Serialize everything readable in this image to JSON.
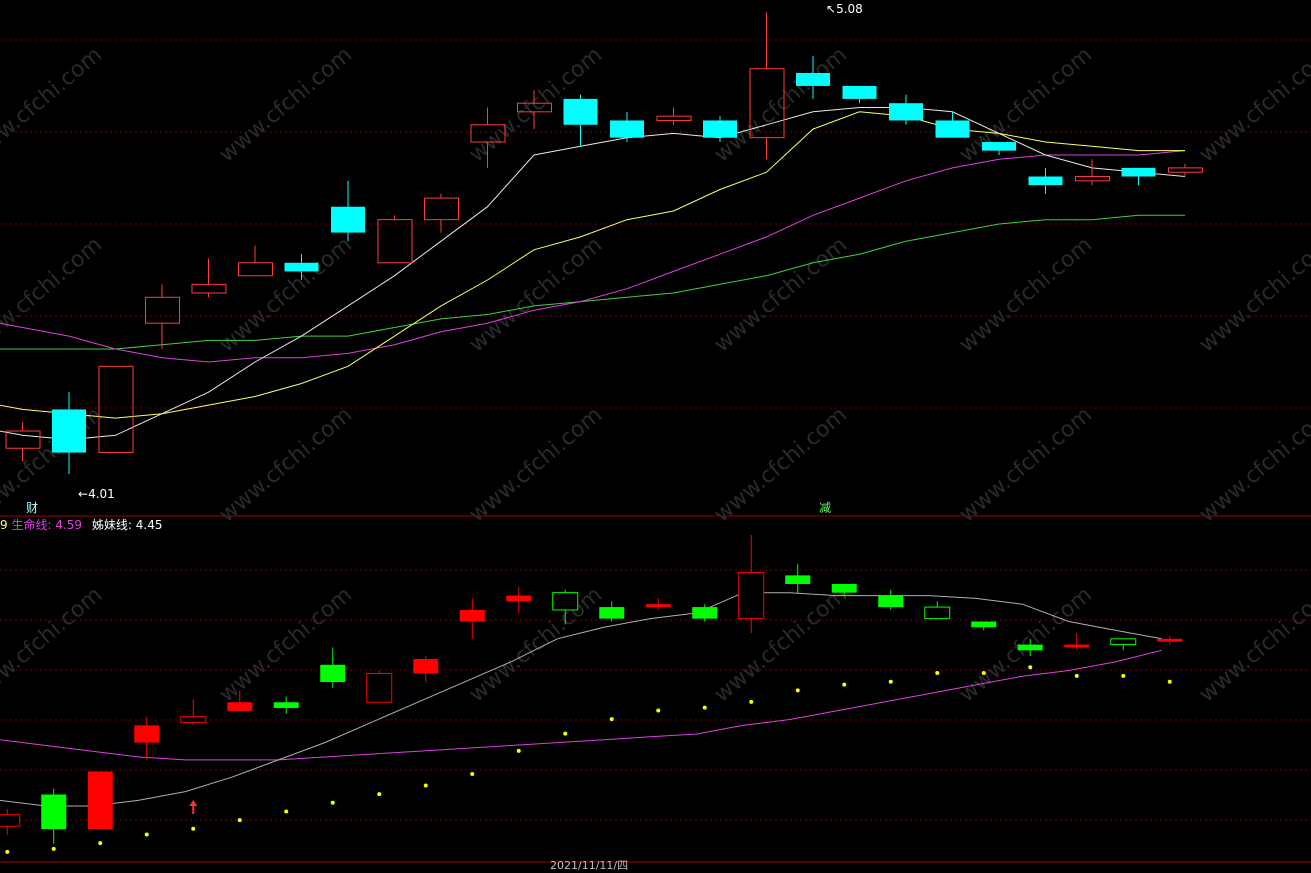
{
  "colors": {
    "background": "#000000",
    "grid": "#7a0000",
    "divider": "#a00000",
    "up_outline": "#ff3c3c",
    "down_fill": "#00ffff",
    "sub_up_fill": "#ff0000",
    "sub_down_fill": "#00ff00",
    "ma_white": "#e8e8e8",
    "ma_yellow": "#ffff66",
    "ma_magenta": "#e040e0",
    "ma_green": "#40d040",
    "dot_yellow": "#ffff00",
    "label_white": "#ffffff",
    "label_magenta": "#e040e0",
    "marker_cai": "#b0ffff",
    "marker_jian": "#60ff60"
  },
  "markers": {
    "high_price": "5.08",
    "low_price": "4.01",
    "cai": "财",
    "jian": "减"
  },
  "indicator_labels": {
    "prefix": "9",
    "life_line_label": "生命线:",
    "life_line_value": "4.59",
    "sister_line_label": "姊妹线:",
    "sister_line_value": "4.45"
  },
  "date_axis": {
    "label": "2021/11/11/四"
  },
  "watermark": {
    "text": "www.cfchi.com"
  },
  "chart_data": {
    "type": "candlestick",
    "price_range": [
      3.95,
      5.1
    ],
    "candles": [
      {
        "o": 4.18,
        "c": 4.07,
        "h": 4.19,
        "l": 4.05
      },
      {
        "o": 4.07,
        "c": 4.11,
        "h": 4.13,
        "l": 4.04
      },
      {
        "o": 4.16,
        "c": 4.06,
        "h": 4.2,
        "l": 4.01
      },
      {
        "o": 4.06,
        "c": 4.26,
        "h": 4.26,
        "l": 4.06
      },
      {
        "o": 4.36,
        "c": 4.42,
        "h": 4.45,
        "l": 4.3
      },
      {
        "o": 4.43,
        "c": 4.45,
        "h": 4.51,
        "l": 4.42
      },
      {
        "o": 4.47,
        "c": 4.5,
        "h": 4.54,
        "l": 4.47
      },
      {
        "o": 4.5,
        "c": 4.48,
        "h": 4.52,
        "l": 4.46
      },
      {
        "o": 4.63,
        "c": 4.57,
        "h": 4.69,
        "l": 4.55
      },
      {
        "o": 4.5,
        "c": 4.6,
        "h": 4.61,
        "l": 4.5
      },
      {
        "o": 4.6,
        "c": 4.65,
        "h": 4.66,
        "l": 4.57
      },
      {
        "o": 4.78,
        "c": 4.82,
        "h": 4.86,
        "l": 4.72
      },
      {
        "o": 4.85,
        "c": 4.87,
        "h": 4.9,
        "l": 4.81
      },
      {
        "o": 4.88,
        "c": 4.82,
        "h": 4.89,
        "l": 4.77
      },
      {
        "o": 4.83,
        "c": 4.79,
        "h": 4.85,
        "l": 4.78
      },
      {
        "o": 4.83,
        "c": 4.84,
        "h": 4.86,
        "l": 4.82
      },
      {
        "o": 4.83,
        "c": 4.79,
        "h": 4.84,
        "l": 4.78
      },
      {
        "o": 4.79,
        "c": 4.95,
        "h": 5.08,
        "l": 4.74
      },
      {
        "o": 4.94,
        "c": 4.91,
        "h": 4.98,
        "l": 4.88
      },
      {
        "o": 4.91,
        "c": 4.88,
        "h": 4.91,
        "l": 4.87
      },
      {
        "o": 4.87,
        "c": 4.83,
        "h": 4.89,
        "l": 4.82
      },
      {
        "o": 4.83,
        "c": 4.79,
        "h": 4.85,
        "l": 4.79
      },
      {
        "o": 4.78,
        "c": 4.76,
        "h": 4.78,
        "l": 4.75
      },
      {
        "o": 4.7,
        "c": 4.68,
        "h": 4.72,
        "l": 4.66
      },
      {
        "o": 4.69,
        "c": 4.7,
        "h": 4.74,
        "l": 4.68
      },
      {
        "o": 4.72,
        "c": 4.7,
        "h": 4.72,
        "l": 4.68
      },
      {
        "o": 4.71,
        "c": 4.72,
        "h": 4.73,
        "l": 4.7
      }
    ],
    "ma_white": [
      4.12,
      4.1,
      4.09,
      4.1,
      4.15,
      4.2,
      4.27,
      4.33,
      4.4,
      4.47,
      4.55,
      4.63,
      4.75,
      4.77,
      4.79,
      4.8,
      4.79,
      4.82,
      4.85,
      4.86,
      4.86,
      4.85,
      4.8,
      4.75,
      4.72,
      4.71,
      4.7
    ],
    "ma_yellow": [
      4.18,
      4.16,
      4.15,
      4.14,
      4.15,
      4.17,
      4.19,
      4.22,
      4.26,
      4.33,
      4.4,
      4.46,
      4.53,
      4.56,
      4.6,
      4.62,
      4.67,
      4.71,
      4.81,
      4.85,
      4.84,
      4.81,
      4.8,
      4.78,
      4.77,
      4.76,
      4.76
    ],
    "ma_magenta": [
      4.37,
      4.35,
      4.33,
      4.3,
      4.28,
      4.27,
      4.28,
      4.28,
      4.29,
      4.31,
      4.34,
      4.36,
      4.39,
      4.41,
      4.44,
      4.48,
      4.52,
      4.56,
      4.61,
      4.65,
      4.69,
      4.72,
      4.74,
      4.75,
      4.75,
      4.75,
      4.76
    ],
    "ma_green": [
      4.3,
      4.3,
      4.3,
      4.3,
      4.31,
      4.32,
      4.32,
      4.33,
      4.33,
      4.35,
      4.37,
      4.38,
      4.4,
      4.41,
      4.42,
      4.43,
      4.45,
      4.47,
      4.5,
      4.52,
      4.55,
      4.57,
      4.59,
      4.6,
      4.6,
      4.61,
      4.61
    ],
    "sub_range": [
      4.05,
      5.08
    ],
    "sub_candles": [
      {
        "o": 4.07,
        "c": 4.11,
        "h": 4.13,
        "l": 4.04
      },
      {
        "o": 4.18,
        "c": 4.06,
        "h": 4.2,
        "l": 4.01
      },
      {
        "o": 4.06,
        "c": 4.26,
        "h": 4.26,
        "l": 4.06
      },
      {
        "o": 4.36,
        "c": 4.42,
        "h": 4.45,
        "l": 4.3
      },
      {
        "o": 4.43,
        "c": 4.45,
        "h": 4.51,
        "l": 4.42
      },
      {
        "o": 4.47,
        "c": 4.5,
        "h": 4.54,
        "l": 4.47
      },
      {
        "o": 4.5,
        "c": 4.48,
        "h": 4.52,
        "l": 4.46
      },
      {
        "o": 4.63,
        "c": 4.57,
        "h": 4.69,
        "l": 4.55
      },
      {
        "o": 4.5,
        "c": 4.6,
        "h": 4.61,
        "l": 4.5
      },
      {
        "o": 4.6,
        "c": 4.65,
        "h": 4.66,
        "l": 4.57
      },
      {
        "o": 4.78,
        "c": 4.82,
        "h": 4.86,
        "l": 4.72
      },
      {
        "o": 4.85,
        "c": 4.87,
        "h": 4.9,
        "l": 4.81
      },
      {
        "o": 4.88,
        "c": 4.82,
        "h": 4.89,
        "l": 4.77
      },
      {
        "o": 4.83,
        "c": 4.79,
        "h": 4.85,
        "l": 4.78
      },
      {
        "o": 4.83,
        "c": 4.84,
        "h": 4.86,
        "l": 4.82
      },
      {
        "o": 4.83,
        "c": 4.79,
        "h": 4.84,
        "l": 4.78
      },
      {
        "o": 4.79,
        "c": 4.95,
        "h": 5.08,
        "l": 4.74
      },
      {
        "o": 4.94,
        "c": 4.91,
        "h": 4.98,
        "l": 4.88
      },
      {
        "o": 4.91,
        "c": 4.88,
        "h": 4.91,
        "l": 4.87
      },
      {
        "o": 4.87,
        "c": 4.83,
        "h": 4.89,
        "l": 4.82
      },
      {
        "o": 4.83,
        "c": 4.79,
        "h": 4.85,
        "l": 4.79
      },
      {
        "o": 4.78,
        "c": 4.76,
        "h": 4.78,
        "l": 4.75
      },
      {
        "o": 4.7,
        "c": 4.68,
        "h": 4.72,
        "l": 4.66
      },
      {
        "o": 4.69,
        "c": 4.7,
        "h": 4.74,
        "l": 4.68
      },
      {
        "o": 4.72,
        "c": 4.7,
        "h": 4.72,
        "l": 4.68
      },
      {
        "o": 4.71,
        "c": 4.72,
        "h": 4.73,
        "l": 4.7
      }
    ],
    "sub_white": [
      4.16,
      4.14,
      4.14,
      4.16,
      4.19,
      4.24,
      4.3,
      4.36,
      4.43,
      4.5,
      4.57,
      4.64,
      4.72,
      4.76,
      4.79,
      4.81,
      4.88,
      4.88,
      4.87,
      4.87,
      4.87,
      4.86,
      4.84,
      4.78,
      4.75,
      4.72
    ],
    "sub_magenta": [
      4.37,
      4.35,
      4.33,
      4.31,
      4.3,
      4.3,
      4.3,
      4.31,
      4.32,
      4.33,
      4.34,
      4.35,
      4.36,
      4.37,
      4.38,
      4.39,
      4.42,
      4.44,
      4.47,
      4.5,
      4.53,
      4.56,
      4.59,
      4.61,
      4.64,
      4.68
    ],
    "sub_dots": [
      4.12,
      4.13,
      4.15,
      4.18,
      4.2,
      4.23,
      4.26,
      4.29,
      4.32,
      4.35,
      4.39,
      4.47,
      4.53,
      4.58,
      4.61,
      4.62,
      4.64,
      4.68,
      4.7,
      4.71,
      4.74,
      4.74,
      4.76,
      4.73,
      4.73,
      4.71
    ]
  }
}
